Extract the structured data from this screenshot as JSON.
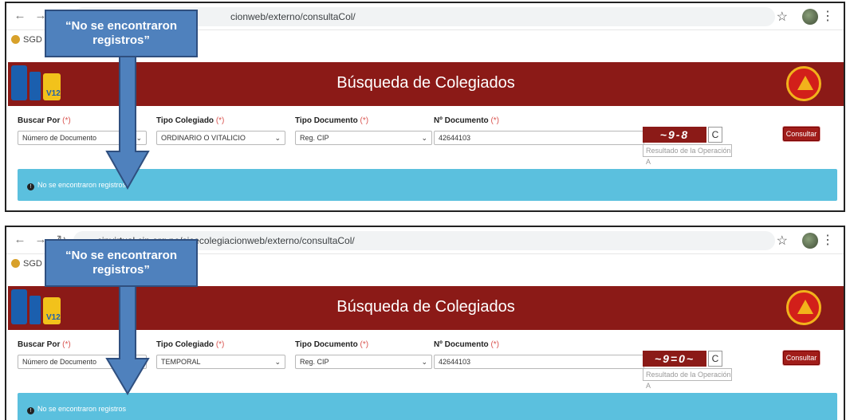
{
  "callouts": [
    {
      "text": "“No se encontraron registros”"
    },
    {
      "text": "“No se encontraron registros”"
    }
  ],
  "panels": [
    {
      "browser": {
        "url_text": "cionweb/externo/consultaCol/",
        "bookmark": "SGD -"
      },
      "site": {
        "title": "Búsqueda de Colegiados",
        "logo_badge": "V12"
      },
      "form": {
        "buscar_por": {
          "label": "Buscar Por",
          "req": "(*)",
          "value": "Número de Documento"
        },
        "tipo_colegiado": {
          "label": "Tipo Colegiado",
          "req": "(*)",
          "value": "ORDINARIO O VITALICIO"
        },
        "tipo_documento": {
          "label": "Tipo Documento",
          "req": "(*)",
          "value": "Reg. CIP"
        },
        "nro_documento": {
          "label": "Nº Documento",
          "req": "(*)",
          "value": "42644103"
        },
        "captcha_text": "~9-8",
        "captcha_placeholder": "Resultado de la Operación A",
        "consult_label": "Consultar"
      },
      "alert": "No se encontraron registros"
    },
    {
      "browser": {
        "url_text": "cipvirtual.cip.org.pe/sicecolegiacionweb/externo/consultaCol/",
        "bookmark": "SGD -"
      },
      "site": {
        "title": "Búsqueda de Colegiados",
        "logo_badge": "V12"
      },
      "form": {
        "buscar_por": {
          "label": "Buscar Por",
          "req": "(*)",
          "value": "Número de Documento"
        },
        "tipo_colegiado": {
          "label": "Tipo Colegiado",
          "req": "(*)",
          "value": "TEMPORAL"
        },
        "tipo_documento": {
          "label": "Tipo Documento",
          "req": "(*)",
          "value": "Reg. CIP"
        },
        "nro_documento": {
          "label": "Nº Documento",
          "req": "(*)",
          "value": "42644103"
        },
        "captcha_text": "~9=0~",
        "captcha_placeholder": "Resultado de la Operación A",
        "consult_label": "Consultar"
      },
      "alert": "No se encontraron registros"
    }
  ],
  "colors": {
    "header": "#8b1a17",
    "alert": "#5bc0de",
    "callout": "#4f81bd"
  },
  "icons": {
    "back": "arrow-left-icon",
    "forward": "arrow-right-icon",
    "reload": "reload-icon",
    "star": "star-icon",
    "menu": "kebab-icon",
    "refresh": "refresh-icon",
    "info": "info-icon"
  }
}
